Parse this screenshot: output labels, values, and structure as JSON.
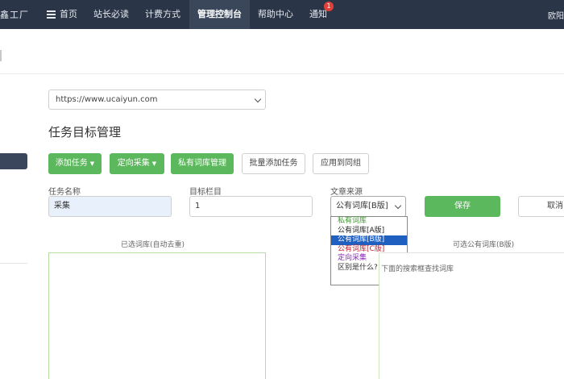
{
  "nav": {
    "brand": "鑫工厂",
    "items": [
      {
        "label": "首页"
      },
      {
        "label": "站长必读"
      },
      {
        "label": "计费方式"
      },
      {
        "label": "管理控制台"
      },
      {
        "label": "帮助中心"
      },
      {
        "label": "通知"
      }
    ],
    "badge": "1",
    "user": "欧阳"
  },
  "site_select": {
    "value": "https://www.ucaiyun.com"
  },
  "page_title": "任务目标管理",
  "toolbar": {
    "add_task": "添加任务",
    "directed_collect": "定向采集",
    "private_lexicon": "私有词库管理",
    "batch_add": "批量添加任务",
    "apply_to_group": "应用到同组"
  },
  "form": {
    "task_name_label": "任务名称",
    "task_name_value": "采集",
    "target_column_label": "目标栏目",
    "target_column_value": "1",
    "source_label": "文章来源",
    "source_value": "公有词库[B版]",
    "source_options": [
      {
        "label": "私有词库",
        "color": "#3a9a2a"
      },
      {
        "label": "公有词库[A版]",
        "color": "#222222"
      },
      {
        "label": "公有词库[B版]",
        "color": "#ffffff"
      },
      {
        "label": "公有词库[C版]",
        "color": "#c02030"
      },
      {
        "label": "定向采集",
        "color": "#8a2ab8"
      },
      {
        "label": "区别是什么?",
        "color": "#333333"
      }
    ],
    "save": "保存",
    "cancel": "取消"
  },
  "panels": {
    "selected_title": "已选词库(自动去重)",
    "available_title": "可选公有词库(B版)",
    "available_hint": "下面的搜索框查找词库"
  },
  "colors": {
    "nav_bg": "#2a3547",
    "green": "#5cb85c",
    "selected_option": "#1f5fbf"
  }
}
